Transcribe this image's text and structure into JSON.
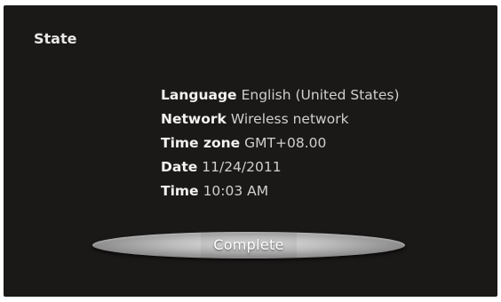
{
  "header": {
    "title": "State"
  },
  "summary": [
    {
      "key": "Language",
      "value": "English (United States)"
    },
    {
      "key": "Network",
      "value": "Wireless network"
    },
    {
      "key": "Time zone",
      "value": "GMT+08.00"
    },
    {
      "key": "Date",
      "value": "11/24/2011"
    },
    {
      "key": "Time",
      "value": "10:03 AM"
    }
  ],
  "actions": {
    "complete_label": "Complete"
  },
  "colors": {
    "background": "#1b1918",
    "text": "#e8e8e8",
    "button": "#bdbdbd"
  }
}
